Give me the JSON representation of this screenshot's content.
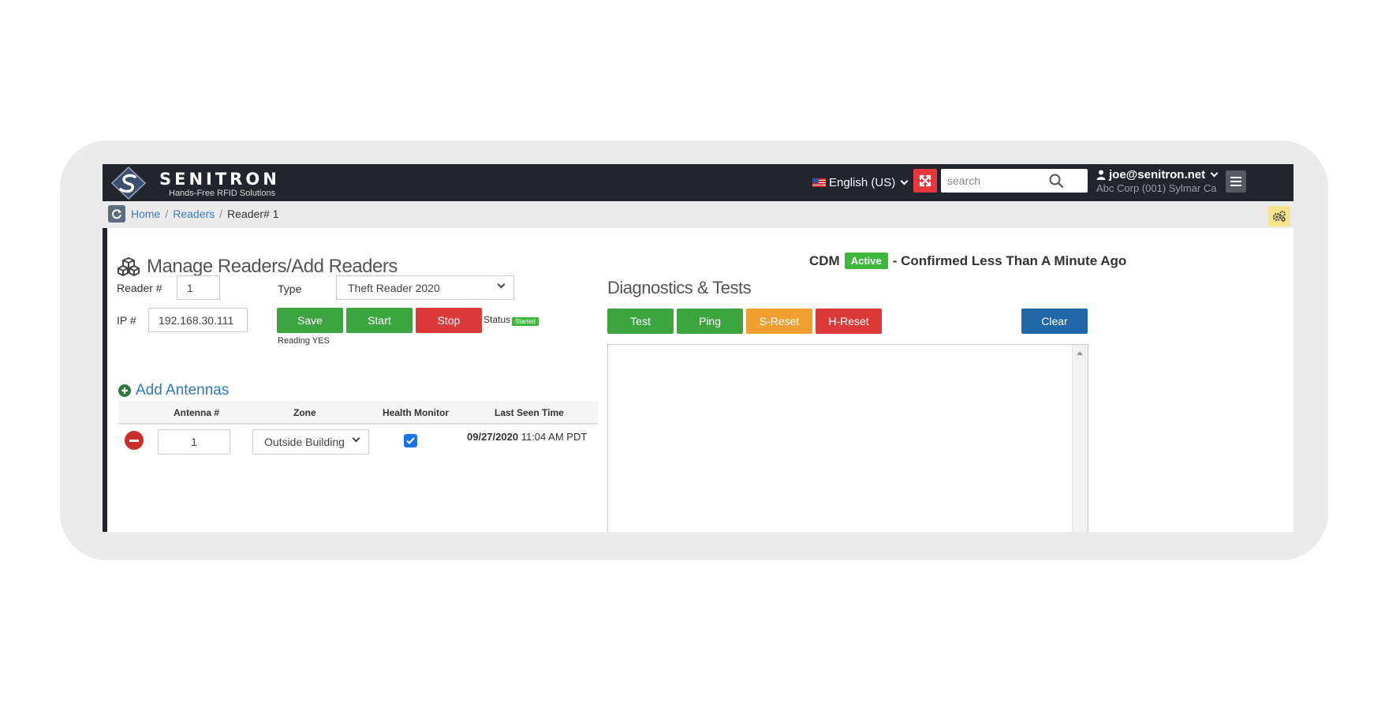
{
  "brand": {
    "name": "SENITRON",
    "tagline": "Hands-Free RFID Solutions"
  },
  "topbar": {
    "language": "English (US)",
    "search_placeholder": "search",
    "user_email": "joe@senitron.net",
    "user_company": "Abc Corp (001) Sylmar Ca"
  },
  "breadcrumb": {
    "home": "Home",
    "sep1": "/",
    "readers": "Readers",
    "sep2": "/",
    "current": "Reader# 1"
  },
  "page": {
    "title": "Manage Readers/Add Readers"
  },
  "cdm": {
    "label": "CDM",
    "badge": "Active",
    "text": "- Confirmed Less Than A Minute Ago"
  },
  "reader_form": {
    "reader_label": "Reader #",
    "reader_value": "1",
    "type_label": "Type",
    "type_value": "Theft Reader 2020",
    "ip_label": "IP #",
    "ip_value": "192.168.30.111",
    "save": "Save",
    "start": "Start",
    "stop": "Stop",
    "status_label": "Status",
    "status_badge": "Started",
    "reading": "Reading YES"
  },
  "antennas": {
    "add_label": "Add Antennas",
    "columns": [
      "Antenna #",
      "Zone",
      "Health Monitor",
      "Last Seen Time"
    ],
    "rows": [
      {
        "antenna": "1",
        "zone": "Outside Building",
        "health_monitor": true,
        "last_seen_date": "09/27/2020",
        "last_seen_time": "11:04 AM PDT"
      }
    ]
  },
  "diagnostics": {
    "title": "Diagnostics & Tests",
    "test": "Test",
    "ping": "Ping",
    "s_reset": "S-Reset",
    "h_reset": "H-Reset",
    "clear": "Clear"
  },
  "colors": {
    "nav_bg": "#22252b",
    "green": "#3da540",
    "red": "#dc3a3a",
    "orange": "#f0a02e",
    "blue": "#1f67a6",
    "link": "#3a7cc7"
  }
}
